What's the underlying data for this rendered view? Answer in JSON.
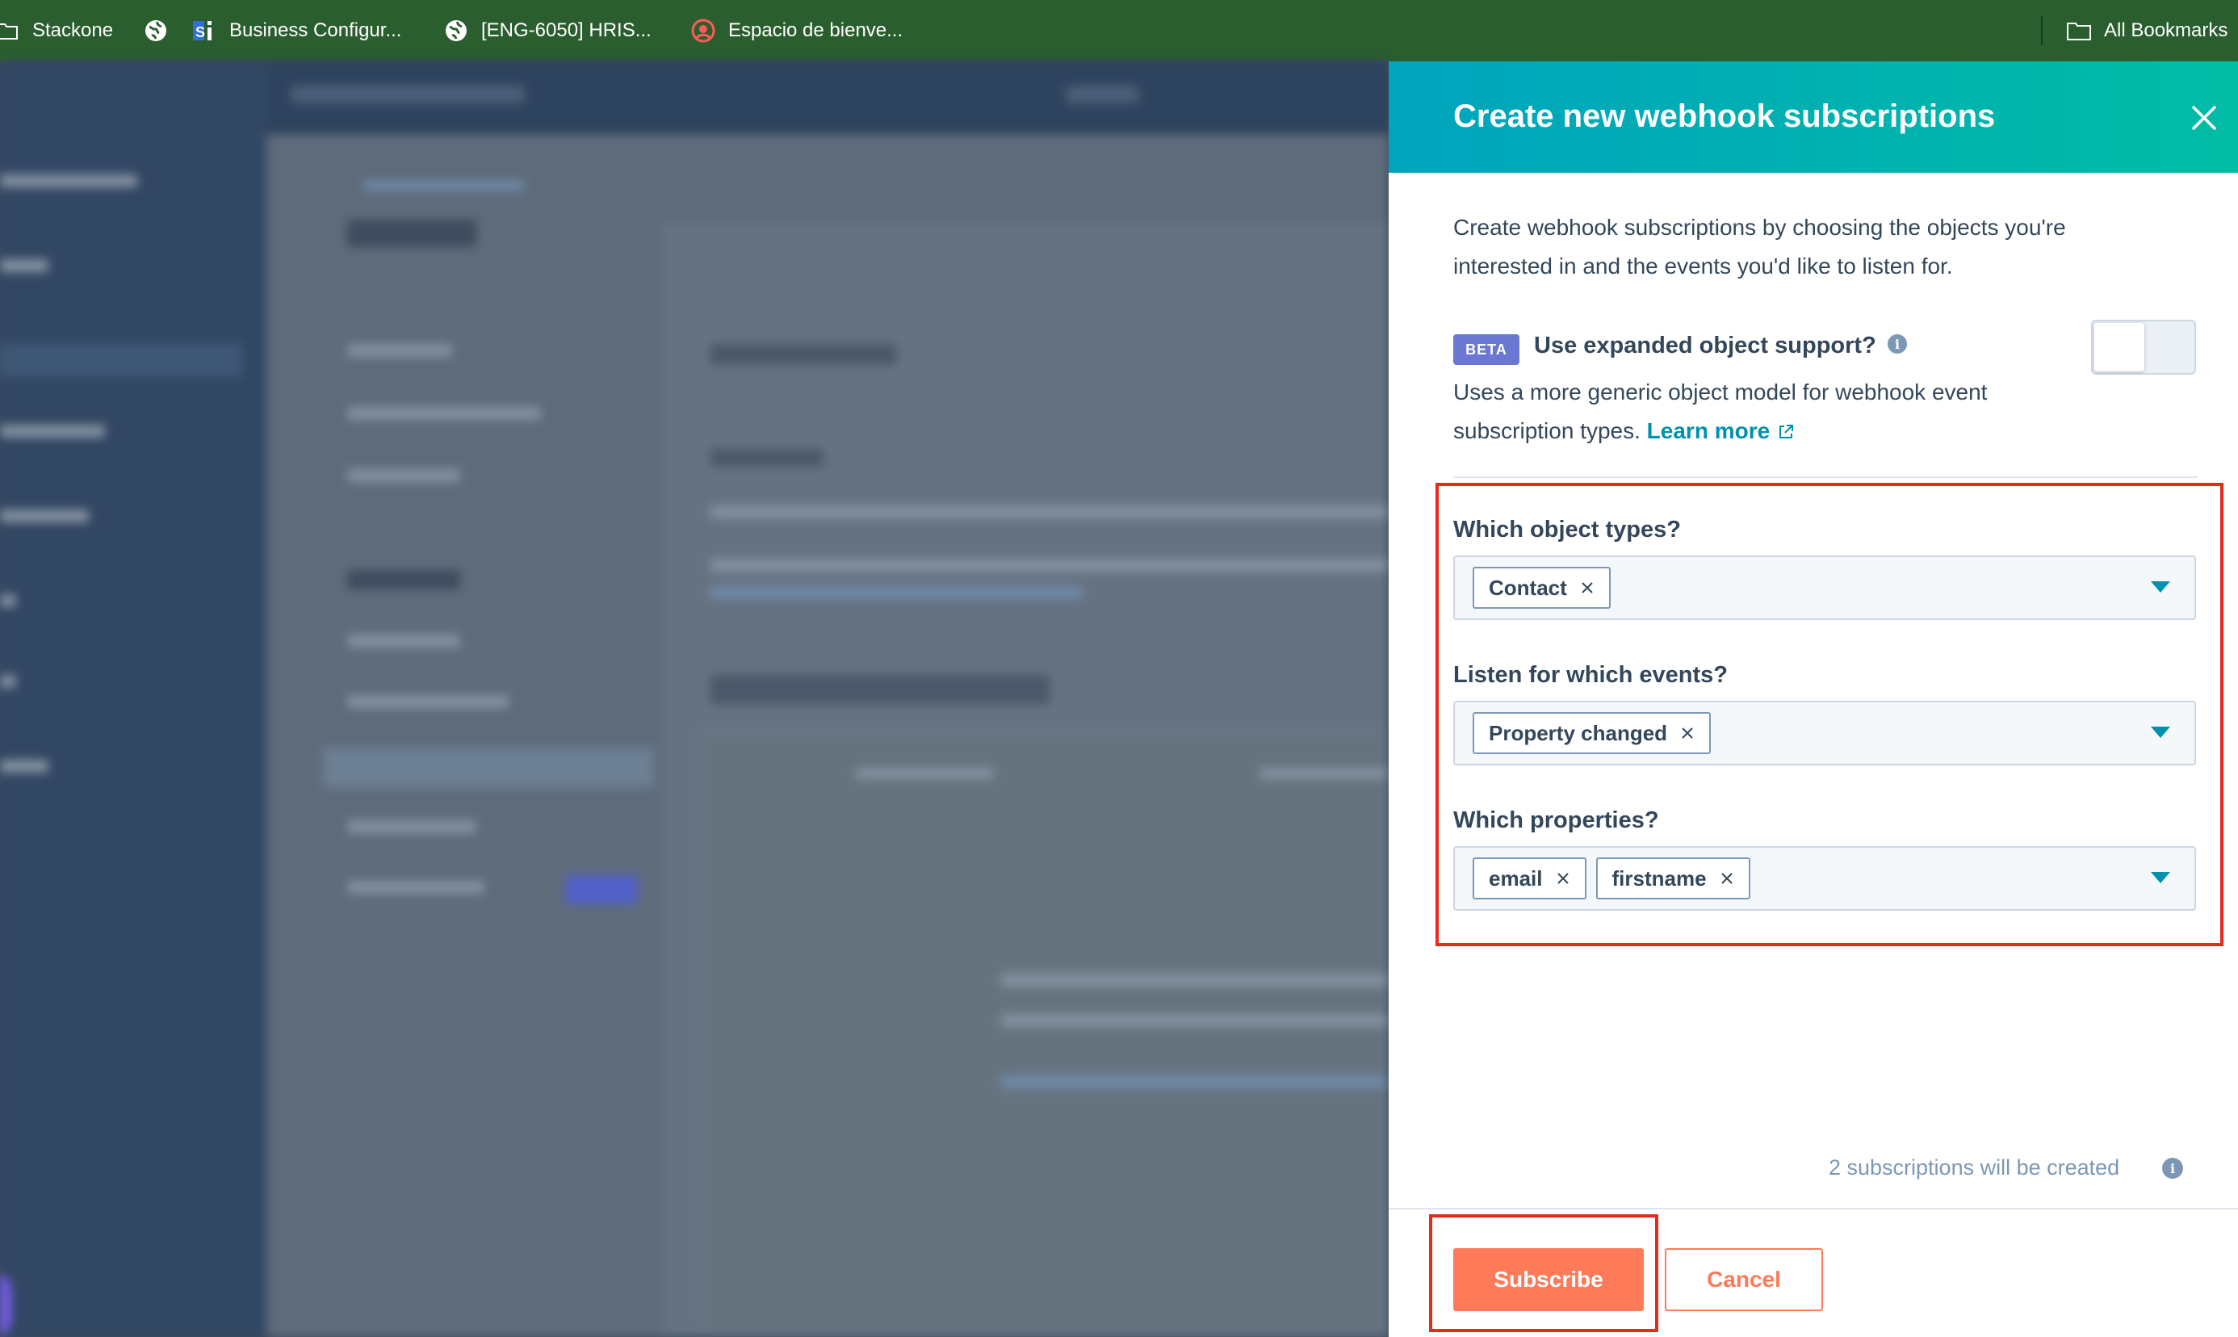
{
  "colors": {
    "bookmarks_bg": "#2b5e2e",
    "header_gradient_start": "#00a4bd",
    "header_gradient_end": "#00bda5",
    "primary_button": "#ff7a59",
    "beta_badge": "#6a78d1",
    "link": "#0091ae",
    "annotation_red": "#e8291c"
  },
  "bookmarks": {
    "items": [
      {
        "label": "Stackone",
        "icon": "folder-icon"
      },
      {
        "label": "Business Configur...",
        "icon": "globe-icon"
      },
      {
        "label": "[ENG-6050] HRIS...",
        "icon": "globe-icon"
      },
      {
        "label": "Espacio de bienve...",
        "icon": "record-icon"
      }
    ],
    "all_bookmarks": "All Bookmarks"
  },
  "panel": {
    "title": "Create new webhook subscriptions",
    "intro_line1": "Create webhook subscriptions by choosing the objects you're",
    "intro_line2": "interested in and the events you'd like to listen for.",
    "beta_badge": "BETA",
    "expanded_label": "Use expanded object support?",
    "expanded_desc_line1": "Uses a more generic object model for webhook event",
    "expanded_desc_line2": "subscription types.",
    "learn_more": "Learn more",
    "expanded_toggle_on": false,
    "fields": {
      "object_types": {
        "label": "Which object types?",
        "chips": [
          "Contact"
        ]
      },
      "events": {
        "label": "Listen for which events?",
        "chips": [
          "Property changed"
        ]
      },
      "properties": {
        "label": "Which properties?",
        "chips": [
          "email",
          "firstname"
        ]
      }
    },
    "subscription_count": "2 subscriptions will be created",
    "subscribe_label": "Subscribe",
    "cancel_label": "Cancel"
  }
}
